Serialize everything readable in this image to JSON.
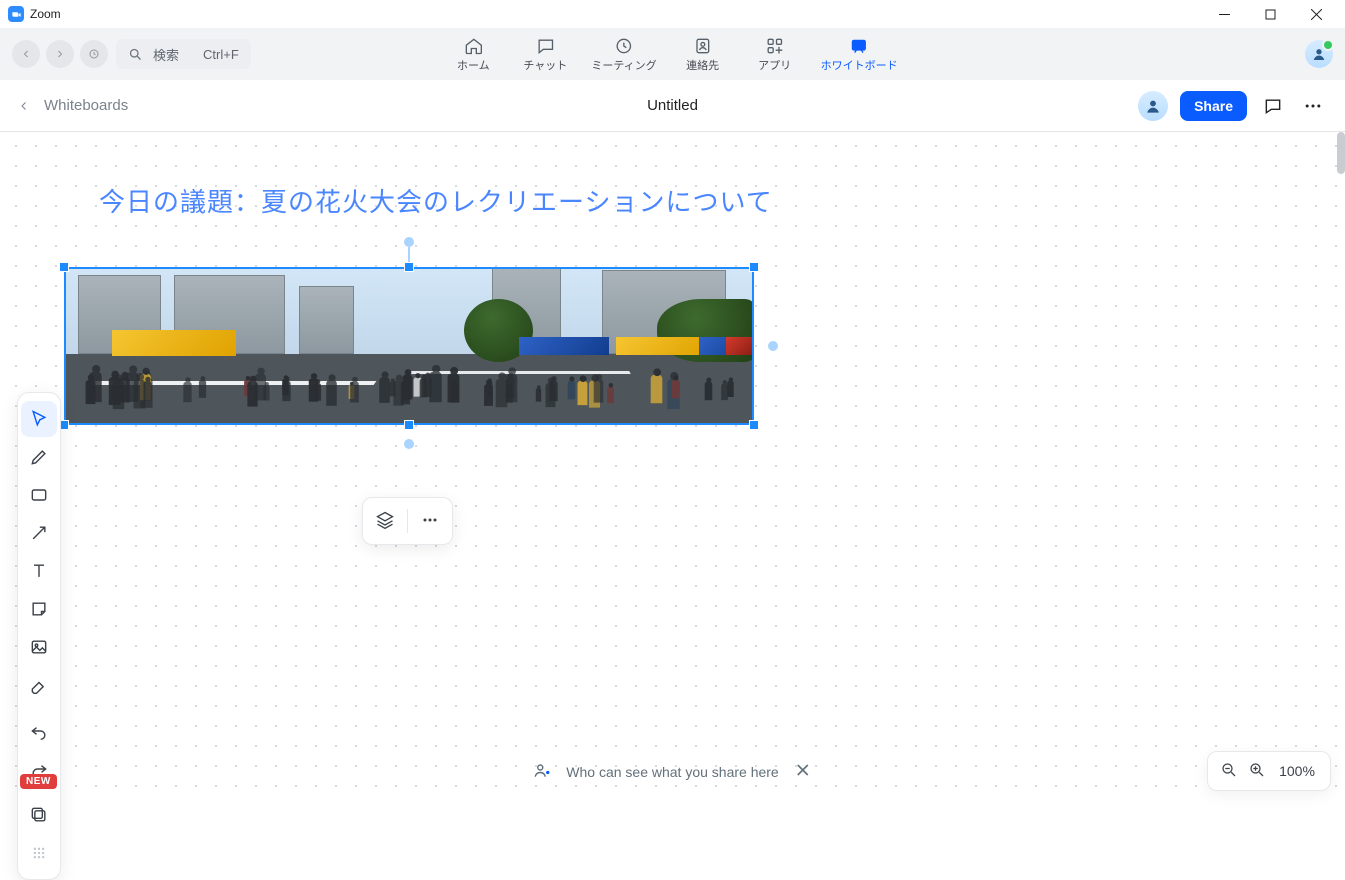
{
  "titlebar": {
    "app_name": "Zoom"
  },
  "topnav": {
    "search_label": "検索",
    "search_shortcut": "Ctrl+F",
    "items": [
      {
        "label": "ホーム",
        "icon": "home-icon"
      },
      {
        "label": "チャット",
        "icon": "chat-icon"
      },
      {
        "label": "ミーティング",
        "icon": "clock-icon"
      },
      {
        "label": "連絡先",
        "icon": "contacts-icon"
      },
      {
        "label": "アプリ",
        "icon": "apps-icon"
      },
      {
        "label": "ホワイトボード",
        "icon": "whiteboard-icon",
        "active": true
      }
    ]
  },
  "wb_header": {
    "back_label": "Whiteboards",
    "title": "Untitled",
    "share_label": "Share"
  },
  "canvas": {
    "heading": "今日の議題：夏の花火大会のレクリエーションについて",
    "image_alt": "街のお祭り風景のパノラマ写真",
    "context_menu": {
      "layers": "layers-icon",
      "more": "more-icon"
    }
  },
  "toolbar": {
    "tools": [
      {
        "name": "select-tool",
        "active": true
      },
      {
        "name": "pen-tool"
      },
      {
        "name": "shape-tool"
      },
      {
        "name": "arrow-tool"
      },
      {
        "name": "text-tool"
      },
      {
        "name": "sticky-note-tool"
      },
      {
        "name": "image-tool"
      },
      {
        "name": "eraser-tool"
      },
      {
        "name": "undo-tool"
      },
      {
        "name": "redo-tool"
      },
      {
        "name": "frames-tool"
      },
      {
        "name": "grid-tool"
      }
    ],
    "new_badge": "NEW"
  },
  "share_hint": {
    "text": "Who can see what you share here"
  },
  "zoom": {
    "percent": "100%"
  },
  "colors": {
    "accent": "#0b5cff",
    "selection": "#1c8bff",
    "heading_text": "#4a86ff"
  }
}
